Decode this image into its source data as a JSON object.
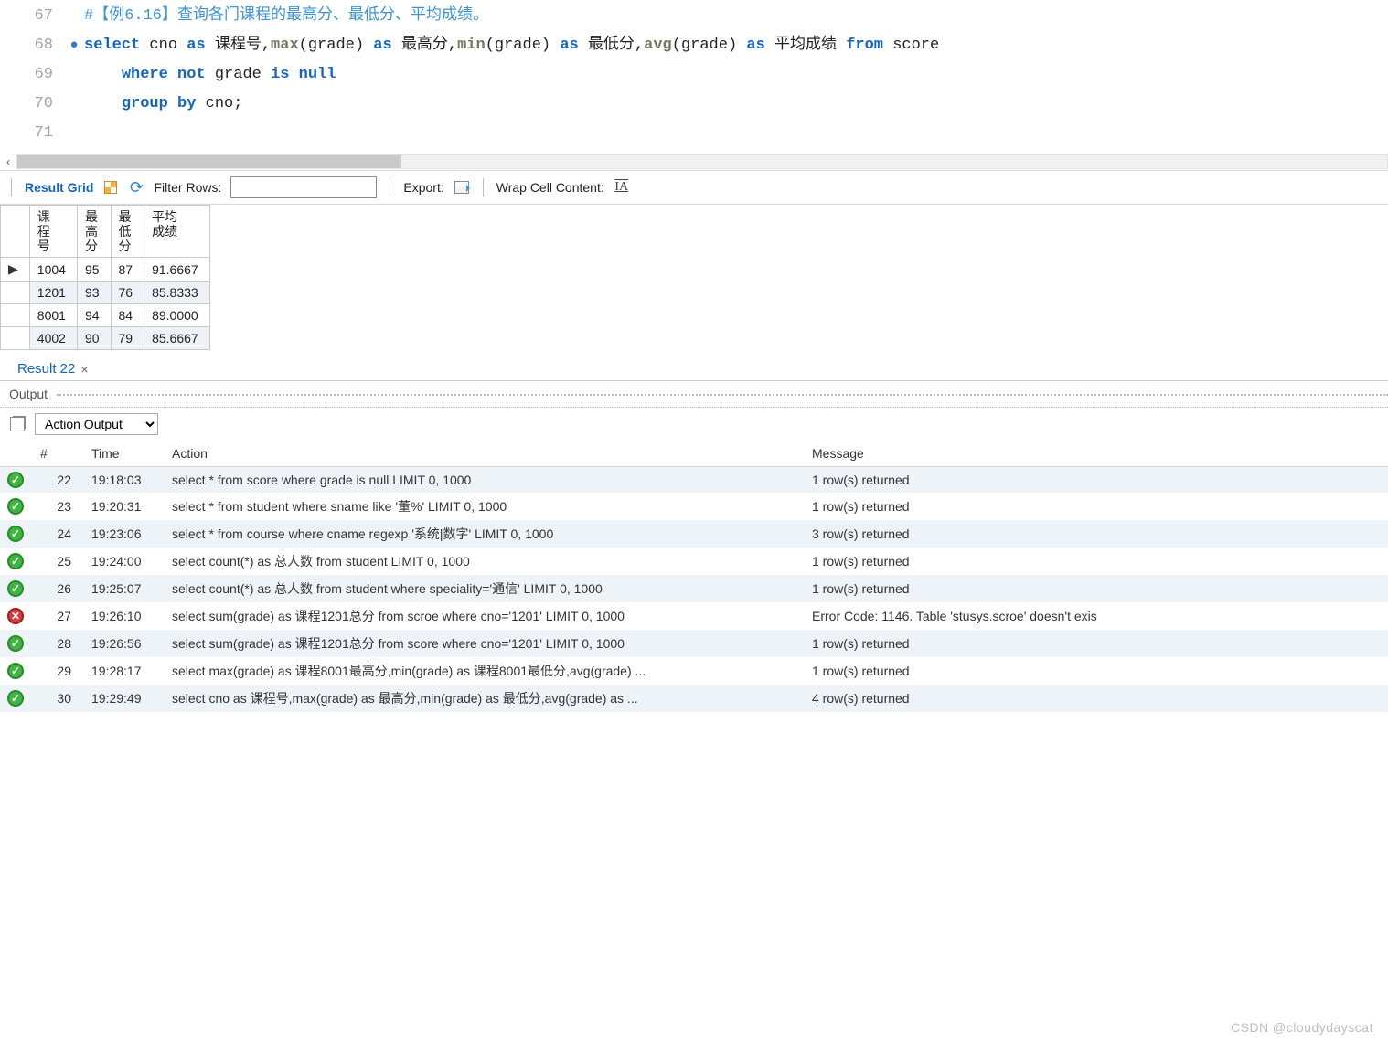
{
  "editor": {
    "lines": [
      {
        "num": 67,
        "marker": "",
        "html": "<span class='cm'>#【例6.16】查询各门课程的最高分、最低分、平均成绩。</span>"
      },
      {
        "num": 68,
        "marker": "●",
        "html": "<span class='kw'>select</span> cno <span class='kw'>as</span> 课程号,<span class='fn'>max</span>(grade) <span class='kw'>as</span> 最高分,<span class='fn'>min</span>(grade) <span class='kw'>as</span> 最低分,<span class='fn'>avg</span>(grade) <span class='kw'>as</span> 平均成绩 <span class='kw'>from</span> score"
      },
      {
        "num": 69,
        "marker": "",
        "html": "    <span class='kw'>where</span> <span class='kw'>not</span> grade <span class='kw'>is</span> <span class='kw'>null</span>"
      },
      {
        "num": 70,
        "marker": "",
        "html": "    <span class='kw'>group</span> <span class='kw'>by</span> cno;"
      },
      {
        "num": 71,
        "marker": "",
        "html": ""
      }
    ]
  },
  "toolbar": {
    "result_grid": "Result Grid",
    "filter_rows": "Filter Rows:",
    "filter_value": "",
    "export": "Export:",
    "wrap": "Wrap Cell Content:"
  },
  "grid": {
    "headers": [
      "课\n程\n号",
      "最\n高\n分",
      "最\n低\n分",
      "平均\n成绩"
    ],
    "rows": [
      {
        "marker": "▶",
        "cells": [
          "1004",
          "95",
          "87",
          "91.6667"
        ]
      },
      {
        "marker": "",
        "cells": [
          "1201",
          "93",
          "76",
          "85.8333"
        ]
      },
      {
        "marker": "",
        "cells": [
          "8001",
          "94",
          "84",
          "89.0000"
        ]
      },
      {
        "marker": "",
        "cells": [
          "4002",
          "90",
          "79",
          "85.6667"
        ]
      }
    ]
  },
  "result_tab": {
    "label": "Result 22",
    "close": "×"
  },
  "output": {
    "title": "Output",
    "selector": "Action Output",
    "headers": {
      "num": "#",
      "time": "Time",
      "action": "Action",
      "message": "Message"
    },
    "rows": [
      {
        "status": "ok",
        "num": 22,
        "time": "19:18:03",
        "action": "select * from score where grade is null LIMIT 0, 1000",
        "message": "1 row(s) returned"
      },
      {
        "status": "ok",
        "num": 23,
        "time": "19:20:31",
        "action": "select * from student where sname like '董%' LIMIT 0, 1000",
        "message": "1 row(s) returned"
      },
      {
        "status": "ok",
        "num": 24,
        "time": "19:23:06",
        "action": "select * from course where cname regexp '系统|数字' LIMIT 0, 1000",
        "message": "3 row(s) returned"
      },
      {
        "status": "ok",
        "num": 25,
        "time": "19:24:00",
        "action": "select count(*) as 总人数 from student LIMIT 0, 1000",
        "message": "1 row(s) returned"
      },
      {
        "status": "ok",
        "num": 26,
        "time": "19:25:07",
        "action": "select count(*) as 总人数 from student  where speciality='通信' LIMIT 0, 1000",
        "message": "1 row(s) returned"
      },
      {
        "status": "err",
        "num": 27,
        "time": "19:26:10",
        "action": "select sum(grade) as 课程1201总分 from scroe where cno='1201' LIMIT 0, 1000",
        "message": "Error Code: 1146. Table 'stusys.scroe' doesn't exis"
      },
      {
        "status": "ok",
        "num": 28,
        "time": "19:26:56",
        "action": "select sum(grade) as 课程1201总分 from score where cno='1201' LIMIT 0, 1000",
        "message": "1 row(s) returned"
      },
      {
        "status": "ok",
        "num": 29,
        "time": "19:28:17",
        "action": "select max(grade) as 课程8001最高分,min(grade) as 课程8001最低分,avg(grade) ...",
        "message": "1 row(s) returned"
      },
      {
        "status": "ok",
        "num": 30,
        "time": "19:29:49",
        "action": "select cno as 课程号,max(grade) as 最高分,min(grade) as 最低分,avg(grade) as ...",
        "message": "4 row(s) returned"
      }
    ]
  },
  "watermark": "CSDN @cloudydayscat"
}
